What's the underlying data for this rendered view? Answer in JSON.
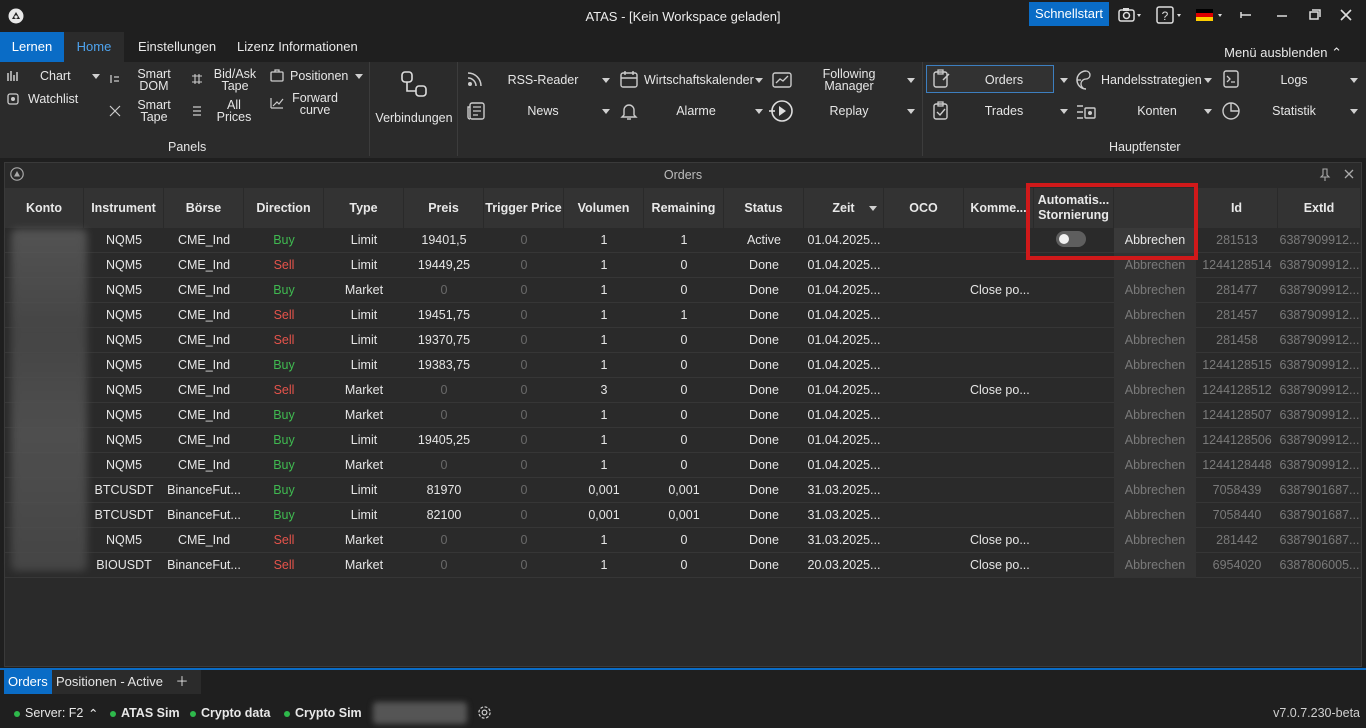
{
  "window": {
    "title": "ATAS - [Kein Workspace geladen]",
    "quickstart": "Schnellstart"
  },
  "menu_tabs": [
    "Lernen",
    "Home",
    "Einstellungen",
    "Lizenz Informationen"
  ],
  "menu_hide": "Menü ausblenden",
  "ribbon": {
    "chart": "Chart",
    "watchlist": "Watchlist",
    "smart_dom": [
      "Smart",
      "DOM"
    ],
    "smart_tape": [
      "Smart",
      "Tape"
    ],
    "bidask_tape": [
      "Bid/Ask",
      "Tape"
    ],
    "all_prices": [
      "All",
      "Prices"
    ],
    "positionen": "Positionen",
    "forward_curve": [
      "Forward",
      "curve"
    ],
    "panels_group": "Panels",
    "verbindungen": "Verbindungen",
    "rss": "RSS-Reader",
    "news": "News",
    "wirtschaftskalender": "Wirtschaftskalender",
    "alarme": "Alarme",
    "following_manager": [
      "Following",
      "Manager"
    ],
    "replay": "Replay",
    "orders": "Orders",
    "trades": "Trades",
    "handelsstrategien": "Handelsstrategien",
    "konten": "Konten",
    "logs": "Logs",
    "statistik": "Statistik",
    "hauptfenster_group": "Hauptfenster"
  },
  "panel": {
    "title": "Orders"
  },
  "columns": [
    "Konto",
    "Instrument",
    "Börse",
    "Direction",
    "Type",
    "Preis",
    "Trigger Price",
    "Volumen",
    "Remaining",
    "Status",
    "Zeit",
    "OCO",
    "Komme...",
    "Automatis... Stornierung",
    "",
    "Id",
    "ExtId"
  ],
  "orders": [
    {
      "instrument": "NQM5",
      "exchange": "CME_Ind",
      "direction": "Buy",
      "type": "Limit",
      "price": "19401,5",
      "trigger": "0",
      "volume": "1",
      "remaining": "1",
      "status": "Active",
      "time": "01.04.2025...",
      "comment": "",
      "action": "Abbrechen",
      "id": "281513",
      "extid": "6387909912..."
    },
    {
      "instrument": "NQM5",
      "exchange": "CME_Ind",
      "direction": "Sell",
      "type": "Limit",
      "price": "19449,25",
      "trigger": "0",
      "volume": "1",
      "remaining": "0",
      "status": "Done",
      "time": "01.04.2025...",
      "comment": "",
      "action": "Abbrechen",
      "id": "1244128514",
      "extid": "6387909912..."
    },
    {
      "instrument": "NQM5",
      "exchange": "CME_Ind",
      "direction": "Buy",
      "type": "Market",
      "price": "0",
      "trigger": "0",
      "volume": "1",
      "remaining": "0",
      "status": "Done",
      "time": "01.04.2025...",
      "comment": "Close po...",
      "action": "Abbrechen",
      "id": "281477",
      "extid": "6387909912..."
    },
    {
      "instrument": "NQM5",
      "exchange": "CME_Ind",
      "direction": "Sell",
      "type": "Limit",
      "price": "19451,75",
      "trigger": "0",
      "volume": "1",
      "remaining": "1",
      "status": "Done",
      "time": "01.04.2025...",
      "comment": "",
      "action": "Abbrechen",
      "id": "281457",
      "extid": "6387909912..."
    },
    {
      "instrument": "NQM5",
      "exchange": "CME_Ind",
      "direction": "Sell",
      "type": "Limit",
      "price": "19370,75",
      "trigger": "0",
      "volume": "1",
      "remaining": "0",
      "status": "Done",
      "time": "01.04.2025...",
      "comment": "",
      "action": "Abbrechen",
      "id": "281458",
      "extid": "6387909912..."
    },
    {
      "instrument": "NQM5",
      "exchange": "CME_Ind",
      "direction": "Buy",
      "type": "Limit",
      "price": "19383,75",
      "trigger": "0",
      "volume": "1",
      "remaining": "0",
      "status": "Done",
      "time": "01.04.2025...",
      "comment": "",
      "action": "Abbrechen",
      "id": "1244128515",
      "extid": "6387909912..."
    },
    {
      "instrument": "NQM5",
      "exchange": "CME_Ind",
      "direction": "Sell",
      "type": "Market",
      "price": "0",
      "trigger": "0",
      "volume": "3",
      "remaining": "0",
      "status": "Done",
      "time": "01.04.2025...",
      "comment": "Close po...",
      "action": "Abbrechen",
      "id": "1244128512",
      "extid": "6387909912..."
    },
    {
      "instrument": "NQM5",
      "exchange": "CME_Ind",
      "direction": "Buy",
      "type": "Market",
      "price": "0",
      "trigger": "0",
      "volume": "1",
      "remaining": "0",
      "status": "Done",
      "time": "01.04.2025...",
      "comment": "",
      "action": "Abbrechen",
      "id": "1244128507",
      "extid": "6387909912..."
    },
    {
      "instrument": "NQM5",
      "exchange": "CME_Ind",
      "direction": "Buy",
      "type": "Limit",
      "price": "19405,25",
      "trigger": "0",
      "volume": "1",
      "remaining": "0",
      "status": "Done",
      "time": "01.04.2025...",
      "comment": "",
      "action": "Abbrechen",
      "id": "1244128506",
      "extid": "6387909912..."
    },
    {
      "instrument": "NQM5",
      "exchange": "CME_Ind",
      "direction": "Buy",
      "type": "Market",
      "price": "0",
      "trigger": "0",
      "volume": "1",
      "remaining": "0",
      "status": "Done",
      "time": "01.04.2025...",
      "comment": "",
      "action": "Abbrechen",
      "id": "1244128448",
      "extid": "6387909912..."
    },
    {
      "instrument": "BTCUSDT",
      "exchange": "BinanceFut...",
      "direction": "Buy",
      "type": "Limit",
      "price": "81970",
      "trigger": "0",
      "volume": "0,001",
      "remaining": "0,001",
      "status": "Done",
      "time": "31.03.2025...",
      "comment": "",
      "action": "Abbrechen",
      "id": "7058439",
      "extid": "6387901687..."
    },
    {
      "instrument": "BTCUSDT",
      "exchange": "BinanceFut...",
      "direction": "Buy",
      "type": "Limit",
      "price": "82100",
      "trigger": "0",
      "volume": "0,001",
      "remaining": "0,001",
      "status": "Done",
      "time": "31.03.2025...",
      "comment": "",
      "action": "Abbrechen",
      "id": "7058440",
      "extid": "6387901687..."
    },
    {
      "instrument": "NQM5",
      "exchange": "CME_Ind",
      "direction": "Sell",
      "type": "Market",
      "price": "0",
      "trigger": "0",
      "volume": "1",
      "remaining": "0",
      "status": "Done",
      "time": "31.03.2025...",
      "comment": "Close po...",
      "action": "Abbrechen",
      "id": "281442",
      "extid": "6387901687..."
    },
    {
      "instrument": "BIOUSDT",
      "exchange": "BinanceFut...",
      "direction": "Sell",
      "type": "Market",
      "price": "0",
      "trigger": "0",
      "volume": "1",
      "remaining": "0",
      "status": "Done",
      "time": "20.03.2025...",
      "comment": "Close po...",
      "action": "Abbrechen",
      "id": "6954020",
      "extid": "6387806005..."
    }
  ],
  "bottom_tabs": [
    "Orders",
    "Positionen - Active"
  ],
  "status": {
    "server": "Server: F2",
    "conn1": "ATAS Sim",
    "conn2": "Crypto data",
    "conn3": "Crypto Sim",
    "version": "v7.0.7.230-beta"
  },
  "colors": {
    "accent": "#0a6cc6",
    "buy": "#3fb950",
    "sell": "#e5534b",
    "highlight": "#d0191a"
  }
}
